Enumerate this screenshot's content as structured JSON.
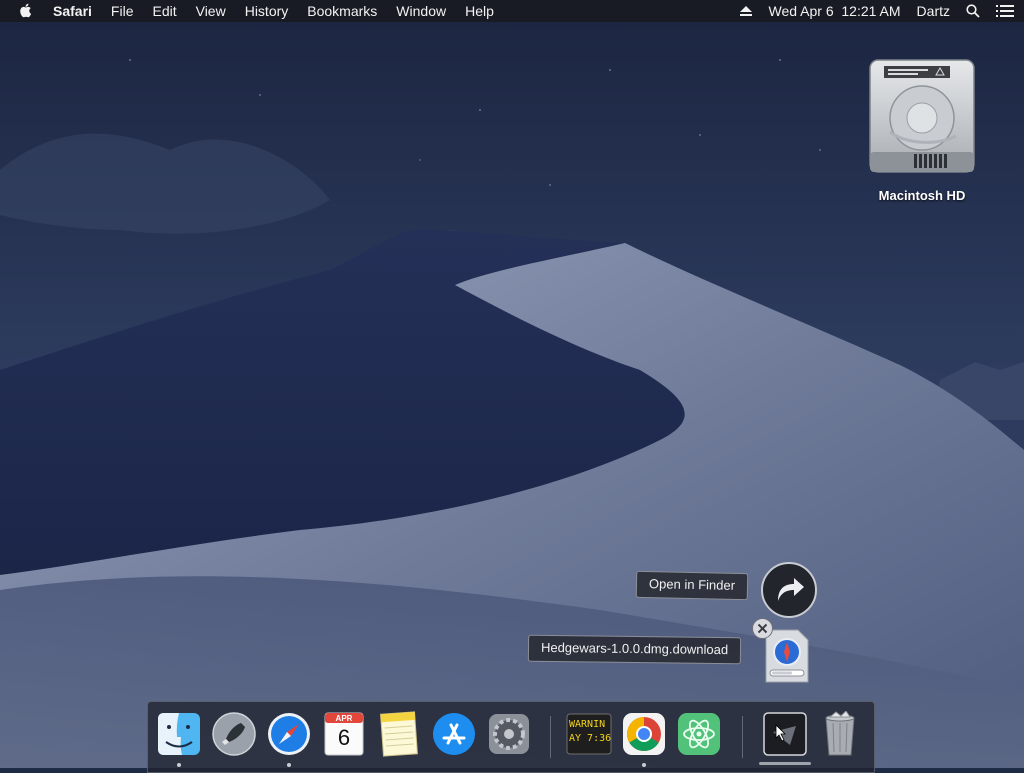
{
  "menubar": {
    "apple_icon": "apple-icon",
    "app_name": "Safari",
    "menus": [
      "File",
      "Edit",
      "View",
      "History",
      "Bookmarks",
      "Window",
      "Help"
    ],
    "datetime": "Wed Apr 6  12:21 AM",
    "user": "Dartz",
    "status_icons": [
      "eject-icon",
      "search-icon",
      "list-icon"
    ]
  },
  "desktop": {
    "drive_label": "Macintosh HD"
  },
  "download_stack": {
    "open_in_finder_label": "Open in Finder",
    "file_name": "Hedgewars-1.0.0.dmg.download"
  },
  "dock": {
    "calendar_month": "APR",
    "calendar_day": "6",
    "console_line1": "WARNIN",
    "console_line2": "AY 7:36",
    "items": [
      "finder",
      "launchpad",
      "safari",
      "calendar",
      "notes",
      "app-store",
      "system-preferences",
      "console",
      "chrome",
      "atom",
      "downloads-stack",
      "trash"
    ]
  },
  "colors": {
    "sky_top": "#1c2640",
    "dune_light": "#7f8aa6",
    "dune_shadow": "#1e2a4e",
    "menubar_bg": "#181a22"
  }
}
